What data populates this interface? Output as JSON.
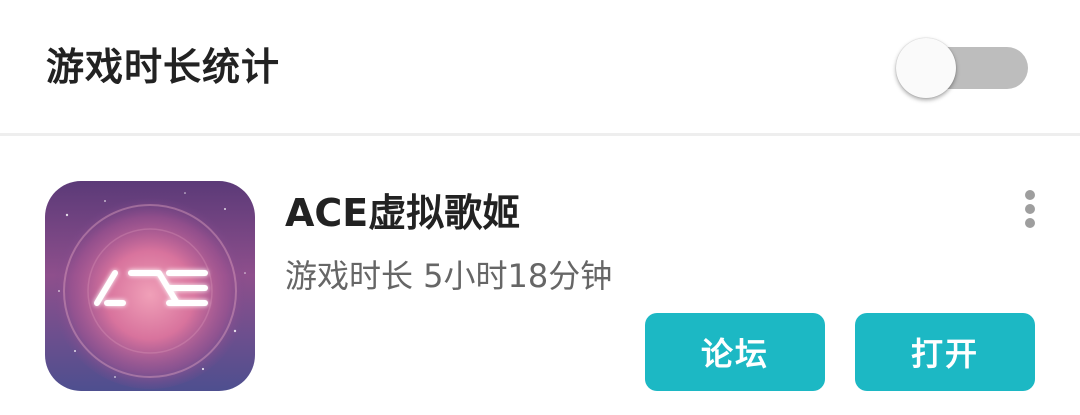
{
  "header": {
    "title": "游戏时长统计",
    "toggle_on": false
  },
  "app": {
    "name": "ACE虚拟歌姬",
    "play_time": "游戏时长 5小时18分钟",
    "icon": "ace-logo-icon",
    "forum_label": "论坛",
    "open_label": "打开"
  },
  "colors": {
    "accent": "#1cb8c4",
    "toggle_track": "#bdbdbd",
    "toggle_thumb": "#fafafa",
    "title_text": "#222222",
    "secondary_text": "#666666"
  }
}
